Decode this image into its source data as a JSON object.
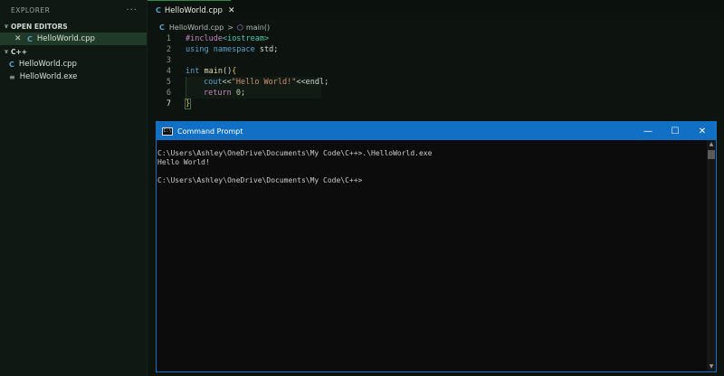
{
  "explorer": {
    "title": "EXPLORER",
    "more": "···",
    "open_editors": {
      "label": "OPEN EDITORS",
      "files": [
        {
          "close": "✕",
          "icon": "C",
          "name": "HelloWorld.cpp"
        }
      ]
    },
    "folder": {
      "label": "C++",
      "files": [
        {
          "icon": "C",
          "name": "HelloWorld.cpp"
        },
        {
          "icon": "≡",
          "name": "HelloWorld.exe"
        }
      ]
    }
  },
  "tab": {
    "icon": "C",
    "name": "HelloWorld.cpp",
    "close": "✕"
  },
  "breadcrumb": {
    "file": "HelloWorld.cpp",
    "separator": ">",
    "symbol": "main()"
  },
  "editor": {
    "line_numbers": [
      "1",
      "2",
      "3",
      "4",
      "5",
      "6",
      "7"
    ],
    "lines": [
      {
        "parts": [
          "#include",
          "<iostream>"
        ]
      },
      {
        "parts": [
          "using namespace",
          " std;"
        ]
      },
      {
        "parts": []
      },
      {
        "parts": [
          "int ",
          "main",
          "()",
          "{"
        ]
      },
      {
        "parts": [
          "cout",
          "<<",
          "\"Hello World!\"",
          "<<endl;"
        ]
      },
      {
        "parts": [
          "return ",
          "0",
          ";"
        ]
      },
      {
        "parts": [
          "}"
        ]
      }
    ]
  },
  "cmd": {
    "title": "Command Prompt",
    "icon_text": "C:\\",
    "minimize": "—",
    "maximize": "☐",
    "close": "✕",
    "lines": [
      "C:\\Users\\Ashley\\OneDrive\\Documents\\My Code\\C++>.\\HelloWorld.exe",
      "Hello World!",
      "",
      "C:\\Users\\Ashley\\OneDrive\\Documents\\My Code\\C++>"
    ]
  },
  "colors": {
    "accent": "#1270c4",
    "active_row": "#1f3a26",
    "tab_border": "#2a8c4a"
  }
}
